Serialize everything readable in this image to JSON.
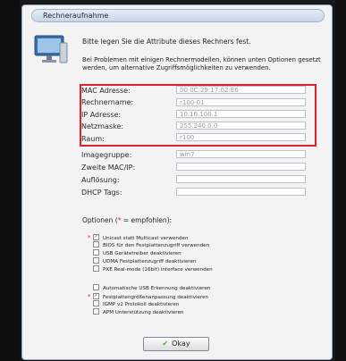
{
  "dialog": {
    "title": "Rechneraufnahme",
    "intro_line1": "Bitte legen Sie die Attribute dieses Rechners fest.",
    "intro_line2": "Bei Problemen mit einigen Rechnermodellen, können unten Optionen gesetzt werden, um alternative Zugriffsmöglichkeiten zu verwenden."
  },
  "fields": [
    {
      "label": "MAC Adresse:",
      "value": "00:0C:29:17:02:E6"
    },
    {
      "label": "Rechnername:",
      "value": "r100-01"
    },
    {
      "label": "IP Adresse:",
      "value": "10.16.100.1"
    },
    {
      "label": "Netzmaske:",
      "value": "255.240.0.0"
    },
    {
      "label": "Raum:",
      "value": "r100"
    },
    {
      "label": "Imagegruppe:",
      "value": "win7"
    },
    {
      "label": "Zweite MAC/IP:",
      "value": ""
    },
    {
      "label": "Auflösung:",
      "value": ""
    },
    {
      "label": "DHCP Tags:",
      "value": ""
    }
  ],
  "options": {
    "title_prefix": "Optionen (",
    "title_star": "*",
    "title_suffix": " = empfohlen):",
    "items": [
      {
        "label": "Unicast statt Multicast verwenden",
        "recommended": true,
        "checked": true
      },
      {
        "label": "BIOS für den Festplattenzugriff verwenden",
        "recommended": false,
        "checked": false
      },
      {
        "label": "USB Gerätetreiber deaktivieren",
        "recommended": false,
        "checked": false
      },
      {
        "label": "UDMA Festplattenzugriff deaktivieren",
        "recommended": false,
        "checked": false
      },
      {
        "label": "PXE Real-mode (16bit) interface verwenden",
        "recommended": false,
        "checked": false
      },
      {
        "label": "Automatische USB Erkennung deaktivieren",
        "recommended": false,
        "checked": false
      },
      {
        "label": "Festplattengrößenanpassung deaktivieren",
        "recommended": true,
        "checked": true
      },
      {
        "label": "IGMP v2 Protokoll deaktivieren",
        "recommended": false,
        "checked": false
      },
      {
        "label": "APM Unterstützung deaktivieren",
        "recommended": false,
        "checked": false
      }
    ]
  },
  "buttons": {
    "ok_label": "Okay"
  },
  "colors": {
    "highlight": "#e2202a",
    "accent": "#3fa83a"
  },
  "icons": {
    "app": "computer-monitor-icon",
    "ok": "checkmark-icon"
  }
}
